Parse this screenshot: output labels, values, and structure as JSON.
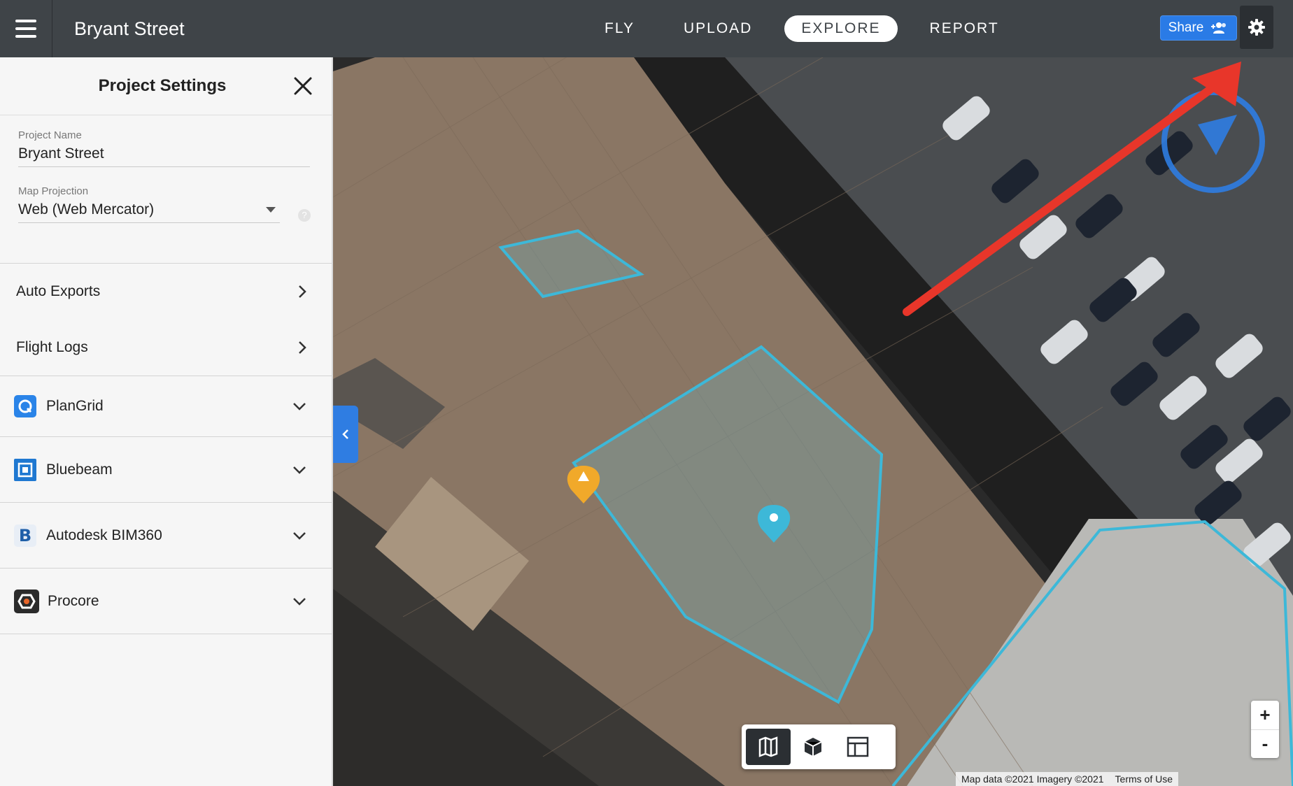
{
  "topbar": {
    "project_title": "Bryant Street",
    "tabs": [
      {
        "label": "FLY",
        "active": false
      },
      {
        "label": "UPLOAD",
        "active": false
      },
      {
        "label": "EXPLORE",
        "active": true
      },
      {
        "label": "REPORT",
        "active": false
      }
    ],
    "share_label": "Share",
    "colors": {
      "bar": "#3f4448",
      "share": "#2a7be6",
      "annotation_arrow": "#e8362a",
      "annotation_circle": "#2f7de2"
    }
  },
  "sidebar": {
    "title": "Project Settings",
    "project_name": {
      "label": "Project Name",
      "value": "Bryant Street"
    },
    "map_projection": {
      "label": "Map Projection",
      "value": "Web (Web Mercator)"
    },
    "help_glyph": "?",
    "links": [
      {
        "label": "Auto Exports",
        "icon": "chevron-right-icon"
      },
      {
        "label": "Flight Logs",
        "icon": "chevron-right-icon"
      }
    ],
    "integrations": [
      {
        "label": "PlanGrid",
        "icon": "plangrid-logo-icon",
        "color": "#2a84e8"
      },
      {
        "label": "Bluebeam",
        "icon": "bluebeam-logo-icon",
        "color": "#1f78d1"
      },
      {
        "label": "Autodesk BIM360",
        "icon": "bim360-logo-icon",
        "color": "#1f5fa8"
      },
      {
        "label": "Procore",
        "icon": "procore-logo-icon",
        "color": "#2b2b2b"
      }
    ]
  },
  "map": {
    "attribution": "Map data ©2021 Imagery ©2021",
    "terms": "Terms of Use",
    "zoom_in": "+",
    "zoom_out": "-",
    "overlay_color": "#3db8d8",
    "warning_marker_color": "#f1a92a",
    "location_marker_color": "#3db8d8"
  }
}
